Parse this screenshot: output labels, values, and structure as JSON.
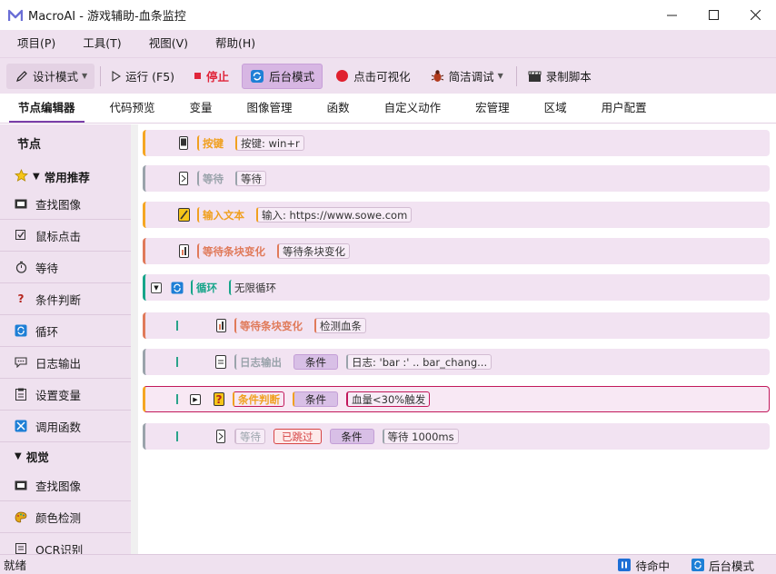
{
  "window": {
    "logo": "M",
    "title": "MacroAI - 游戏辅助-血条监控",
    "minimize_icon": "minimize-icon",
    "maximize_icon": "maximize-icon",
    "close_icon": "close-icon"
  },
  "menu": [
    "项目(P)",
    "工具(T)",
    "视图(V)",
    "帮助(H)"
  ],
  "toolbar": {
    "design_mode": "设计模式",
    "run": "运行 (F5)",
    "stop": "停止",
    "background_mode": "后台模式",
    "click_visualize": "点击可视化",
    "simple_debug": "简洁调试",
    "record_script": "录制脚本"
  },
  "tabs": [
    "节点编辑器",
    "代码预览",
    "变量",
    "图像管理",
    "函数",
    "自定义动作",
    "宏管理",
    "区域",
    "用户配置"
  ],
  "sidebar": {
    "header": "节点",
    "group_common": "常用推荐",
    "common_items": [
      "查找图像",
      "鼠标点击",
      "等待",
      "条件判断",
      "循环",
      "日志输出",
      "设置变量",
      "调用函数"
    ],
    "group_vision": "视觉",
    "vision_items": [
      "查找图像",
      "颜色检测",
      "OCR识别"
    ]
  },
  "nodes": [
    {
      "title": "按键",
      "detail": "按键: win+r"
    },
    {
      "title": "等待",
      "detail": "等待"
    },
    {
      "title": "输入文本",
      "detail": "输入: https://www.sowe.com"
    },
    {
      "title": "等待条块变化",
      "detail": "等待条块变化"
    },
    {
      "title": "循环",
      "detail": "无限循环"
    },
    {
      "title": "等待条块变化",
      "detail": "检测血条"
    },
    {
      "title": "日志输出",
      "cond": "条件",
      "detail": "日志: 'bar :' .. bar_chang..."
    },
    {
      "title": "条件判断",
      "cond": "条件",
      "detail": "血量<30%触发"
    },
    {
      "title": "等待",
      "skipped": "已跳过",
      "cond": "条件",
      "detail": "等待 1000ms"
    }
  ],
  "status": {
    "left": "就绪",
    "idle": "待命中",
    "mode": "后台模式"
  }
}
